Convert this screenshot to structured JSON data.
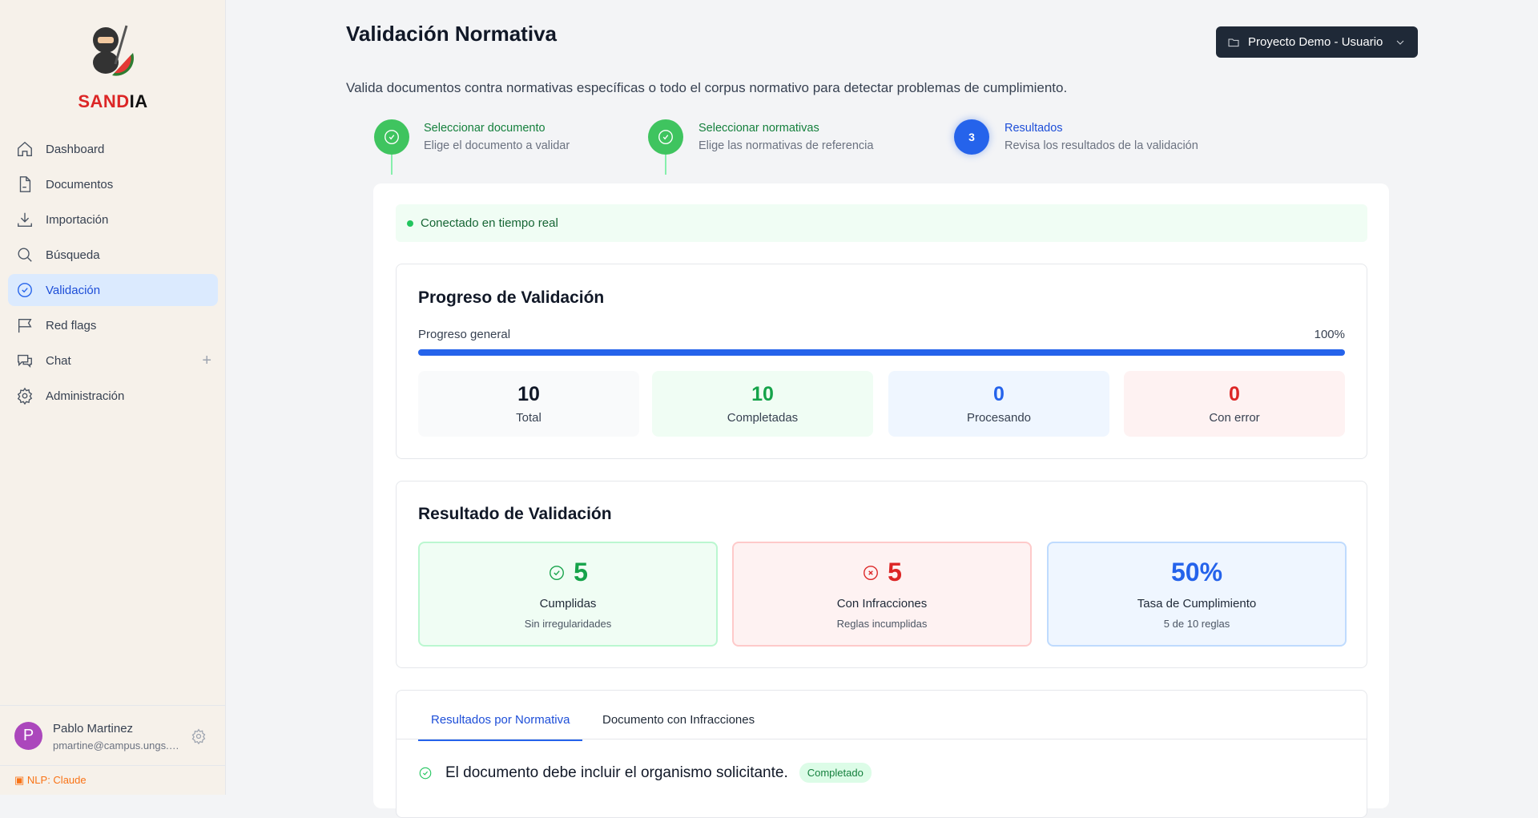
{
  "brand": {
    "part1": "SAND",
    "part2": "IA"
  },
  "sidebar": {
    "items": [
      {
        "label": "Dashboard"
      },
      {
        "label": "Documentos"
      },
      {
        "label": "Importación"
      },
      {
        "label": "Búsqueda"
      },
      {
        "label": "Validación"
      },
      {
        "label": "Red flags"
      },
      {
        "label": "Chat"
      },
      {
        "label": "Administración"
      }
    ]
  },
  "user": {
    "initial": "P",
    "name": "Pablo Martinez",
    "email": "pmartine@campus.ungs.…"
  },
  "nlp": "NLP: Claude",
  "header": {
    "title": "Validación Normativa",
    "project": "Proyecto Demo - Usuario",
    "subtitle": "Valida documentos contra normativas específicas o todo el corpus normativo para detectar problemas de cumplimiento."
  },
  "steps": [
    {
      "title": "Seleccionar documento",
      "desc": "Elige el documento a validar"
    },
    {
      "title": "Seleccionar normativas",
      "desc": "Elige las normativas de referencia"
    },
    {
      "number": "3",
      "title": "Resultados",
      "desc": "Revisa los resultados de la validación"
    }
  ],
  "banner": "Conectado en tiempo real",
  "progress": {
    "title": "Progreso de Validación",
    "label": "Progreso general",
    "value_text": "100%",
    "value": 100,
    "stats": [
      {
        "n": "10",
        "l": "Total"
      },
      {
        "n": "10",
        "l": "Completadas"
      },
      {
        "n": "0",
        "l": "Procesando"
      },
      {
        "n": "0",
        "l": "Con error"
      }
    ]
  },
  "results": {
    "title": "Resultado de Validación",
    "cards": [
      {
        "n": "5",
        "l": "Cumplidas",
        "s": "Sin irregularidades"
      },
      {
        "n": "5",
        "l": "Con Infracciones",
        "s": "Reglas incumplidas"
      },
      {
        "n": "50%",
        "l": "Tasa de Cumplimiento",
        "s": "5 de 10 reglas"
      }
    ]
  },
  "tabs": [
    {
      "label": "Resultados por Normativa"
    },
    {
      "label": "Documento con Infracciones"
    }
  ],
  "list": [
    {
      "text": "El documento debe incluir el organismo solicitante.",
      "status": "Completado"
    }
  ]
}
